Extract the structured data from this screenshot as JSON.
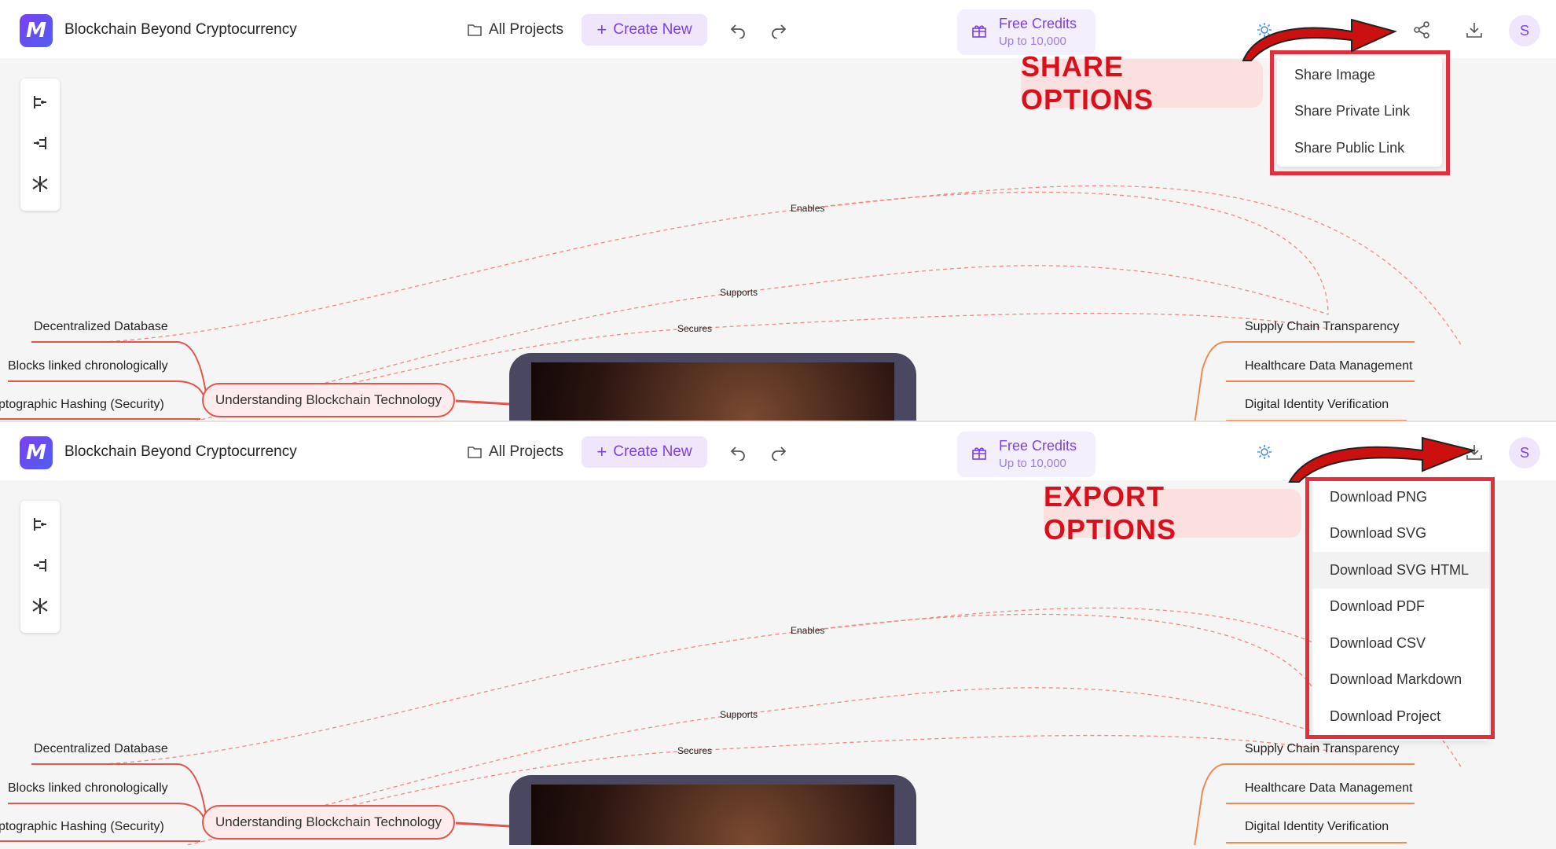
{
  "app": {
    "title": "Blockchain Beyond Cryptocurrency",
    "all_projects": "All Projects",
    "create_new": "Create New",
    "free_credits": "Free Credits",
    "credits_sub": "Up to 10,000",
    "avatar_initial": "S"
  },
  "mindmap": {
    "central": "Understanding Blockchain Technology",
    "left_nodes": [
      "Decentralized Database",
      "Blocks linked chronologically",
      "ptographic Hashing (Security)"
    ],
    "right_nodes": [
      "Supply Chain Transparency",
      "Healthcare Data Management",
      "Digital Identity Verification"
    ],
    "edge_labels": [
      "Enables",
      "Supports",
      "Secures"
    ]
  },
  "share": {
    "callout": "SHARE OPTIONS",
    "items": [
      "Share Image",
      "Share Private Link",
      "Share Public Link"
    ]
  },
  "export": {
    "callout": "EXPORT OPTIONS",
    "items": [
      "Download PNG",
      "Download SVG",
      "Download SVG HTML",
      "Download PDF",
      "Download CSV",
      "Download Markdown",
      "Download Project"
    ]
  },
  "colors": {
    "accent": "#7b3ff2",
    "edge": "#e2554a",
    "highlight_red": "#e22f3c"
  }
}
